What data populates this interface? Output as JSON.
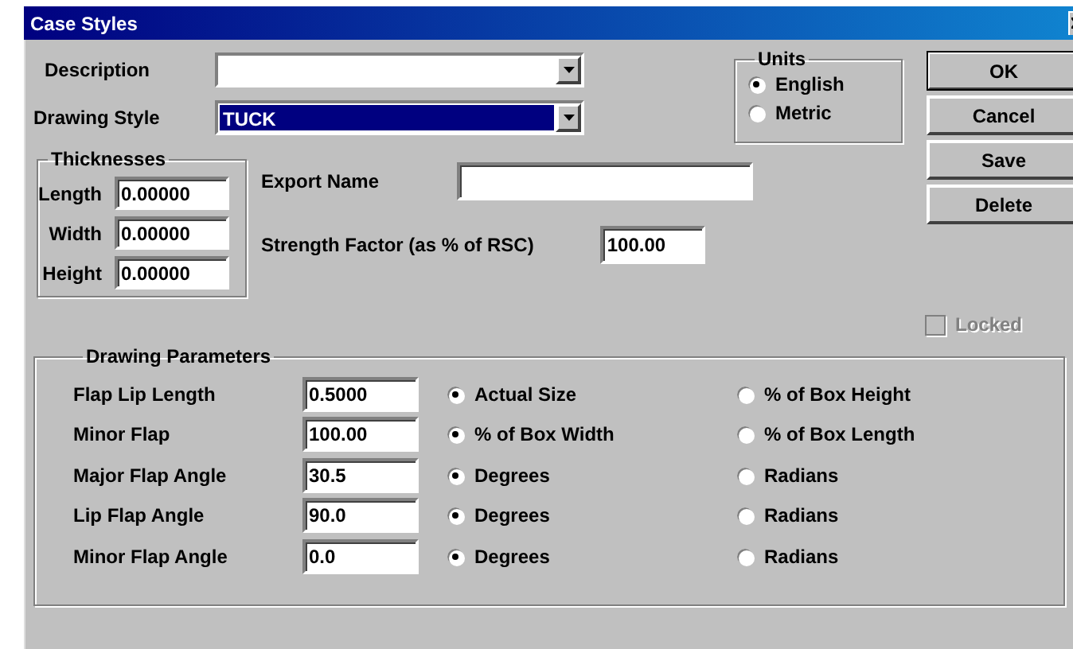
{
  "window": {
    "title": "Case Styles"
  },
  "description": {
    "label": "Description"
  },
  "drawing_style": {
    "label": "Drawing Style",
    "value": "TUCK"
  },
  "units": {
    "title": "Units",
    "options": [
      {
        "label": "English",
        "selected": true
      },
      {
        "label": "Metric",
        "selected": false
      }
    ]
  },
  "buttons": [
    {
      "label": "OK",
      "default": true
    },
    {
      "label": "Cancel",
      "default": false
    },
    {
      "label": "Save",
      "default": false
    },
    {
      "label": "Delete",
      "default": false
    }
  ],
  "thicknesses": {
    "title": "Thicknesses",
    "fields": [
      {
        "label": "Length",
        "value": "0.00000"
      },
      {
        "label": "Width",
        "value": "0.00000"
      },
      {
        "label": "Height",
        "value": "0.00000"
      }
    ]
  },
  "export_name": {
    "label": "Export Name"
  },
  "strength_factor": {
    "label": "Strength Factor (as % of RSC)",
    "value": "100.00"
  },
  "locked": {
    "label": "Locked",
    "checked": false,
    "disabled": true
  },
  "drawing_parameters": {
    "title": "Drawing Parameters",
    "rows": [
      {
        "label": "Flap Lip Length",
        "value": "0.5000",
        "options": [
          {
            "label": "Actual Size",
            "selected": true
          },
          {
            "label": "% of Box Height",
            "selected": false
          }
        ]
      },
      {
        "label": "Minor Flap",
        "value": "100.00",
        "options": [
          {
            "label": "% of Box Width",
            "selected": true
          },
          {
            "label": "% of Box Length",
            "selected": false
          }
        ]
      },
      {
        "label": "Major Flap Angle",
        "value": "30.5",
        "options": [
          {
            "label": "Degrees",
            "selected": true
          },
          {
            "label": "Radians",
            "selected": false
          }
        ]
      },
      {
        "label": "Lip Flap Angle",
        "value": "90.0",
        "options": [
          {
            "label": "Degrees",
            "selected": true
          },
          {
            "label": "Radians",
            "selected": false
          }
        ]
      },
      {
        "label": "Minor Flap Angle",
        "value": "0.0",
        "options": [
          {
            "label": "Degrees",
            "selected": true
          },
          {
            "label": "Radians",
            "selected": false
          }
        ]
      }
    ]
  }
}
